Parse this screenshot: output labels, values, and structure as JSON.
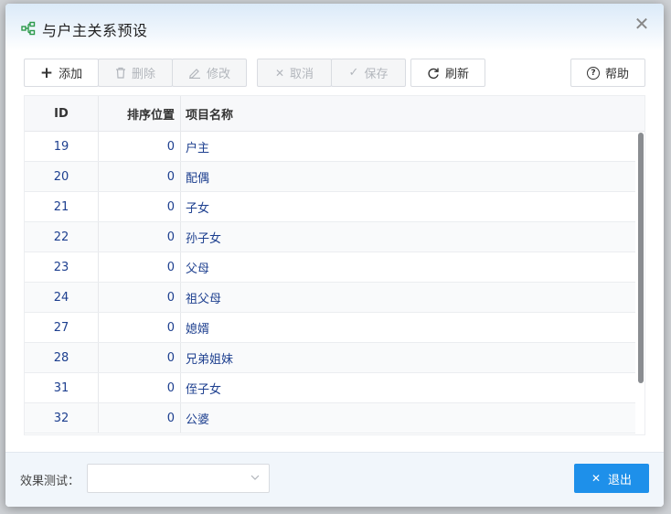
{
  "dialog": {
    "title": "与户主关系预设",
    "close_glyph": "✕"
  },
  "toolbar": {
    "add": {
      "icon": "plus-icon",
      "glyph": "+",
      "label": "添加"
    },
    "delete": {
      "icon": "trash-icon",
      "label": "删除"
    },
    "edit": {
      "icon": "pencil-icon",
      "label": "修改"
    },
    "cancel": {
      "icon": "x-icon",
      "glyph": "✕",
      "label": "取消"
    },
    "save": {
      "icon": "check-icon",
      "glyph": "✓",
      "label": "保存"
    },
    "refresh": {
      "icon": "refresh-icon",
      "label": "刷新"
    },
    "help": {
      "icon": "help-circle-icon",
      "glyph": "?",
      "label": "帮助"
    }
  },
  "table": {
    "columns": [
      "ID",
      "排序位置",
      "项目名称"
    ],
    "rows": [
      {
        "id": "19",
        "pos": "0",
        "name": "户主"
      },
      {
        "id": "20",
        "pos": "0",
        "name": "配偶"
      },
      {
        "id": "21",
        "pos": "0",
        "name": "子女"
      },
      {
        "id": "22",
        "pos": "0",
        "name": "孙子女"
      },
      {
        "id": "23",
        "pos": "0",
        "name": "父母"
      },
      {
        "id": "24",
        "pos": "0",
        "name": "祖父母"
      },
      {
        "id": "27",
        "pos": "0",
        "name": "媳婿"
      },
      {
        "id": "28",
        "pos": "0",
        "name": "兄弟姐妹"
      },
      {
        "id": "31",
        "pos": "0",
        "name": "侄子女"
      },
      {
        "id": "32",
        "pos": "0",
        "name": "公婆"
      }
    ]
  },
  "footer": {
    "test_label": "效果测试：",
    "select_value": "",
    "exit_label": "退出",
    "exit_glyph": "✕"
  },
  "colors": {
    "accent": "#1e90ea",
    "row_text": "#1d3f8f",
    "disabled_text": "#b2b6bc"
  }
}
